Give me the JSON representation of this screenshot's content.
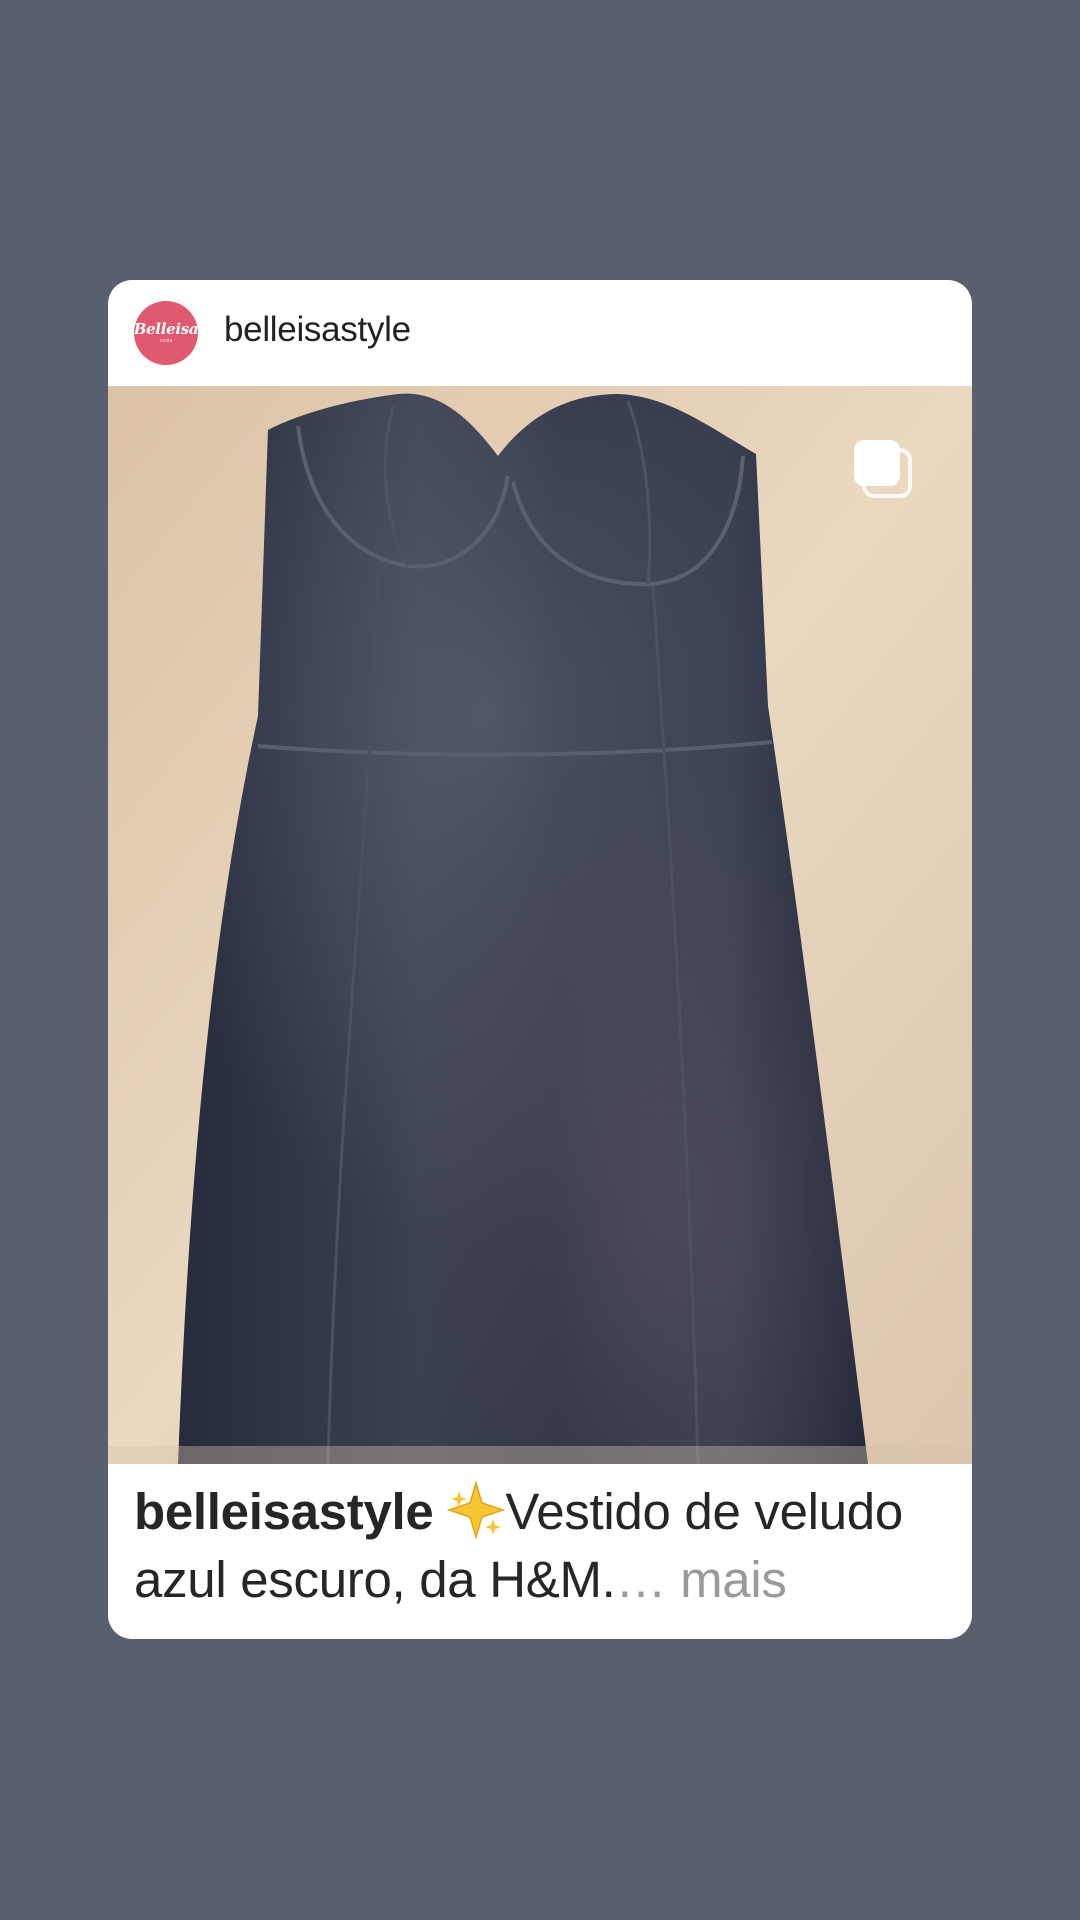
{
  "post": {
    "username": "belleisastyle",
    "avatar": {
      "logo_text": "Belleisa",
      "logo_subtext": "moda",
      "color": "#e0596f"
    },
    "media": {
      "description_icon": "carousel-multiple-icon",
      "subject": "dress-photo"
    },
    "caption": {
      "username": "belleisastyle",
      "emoji": "sparkle-star-icon",
      "text": "Vestido de veludo azul escuro, da H&M.",
      "ellipsis": "…",
      "more_label": "mais"
    }
  },
  "colors": {
    "background": "#59606d",
    "card": "#ffffff",
    "text": "#262626",
    "muted": "#9a9a9a",
    "dress": "#2a3142",
    "carpet": "#e6d2b8"
  }
}
